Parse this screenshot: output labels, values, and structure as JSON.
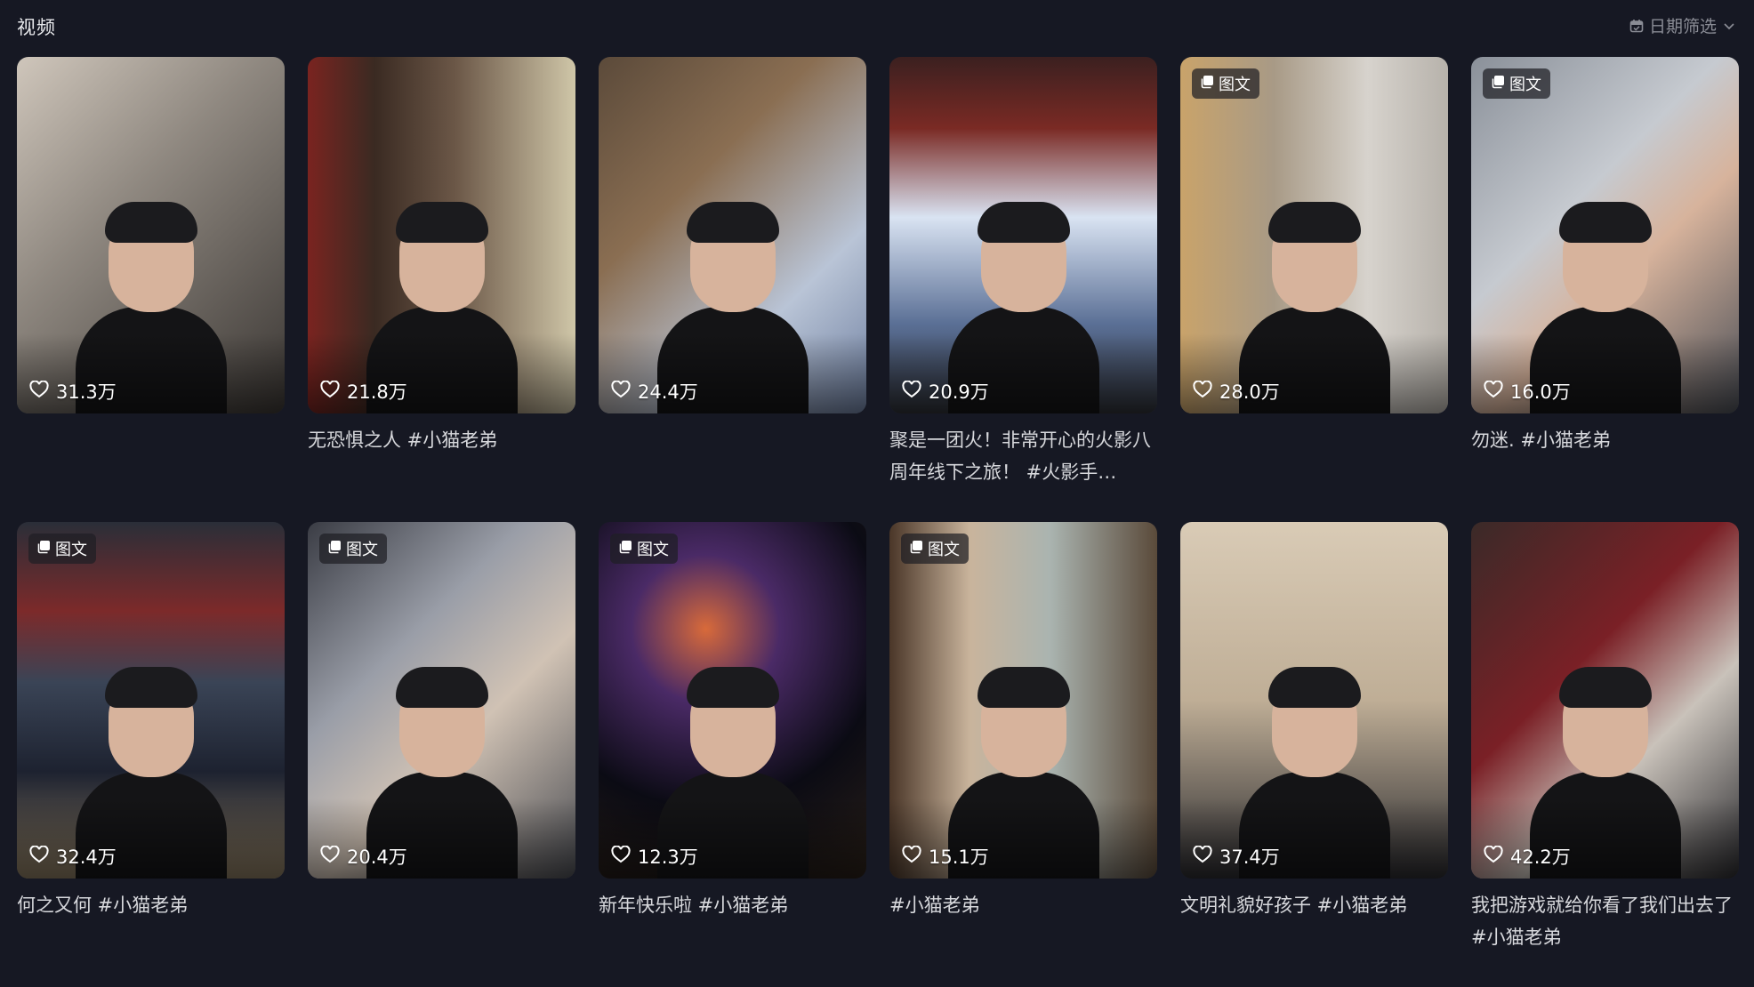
{
  "header": {
    "title": "视频",
    "filter_label": "日期筛选",
    "filter_icon": "calendar-icon",
    "chevron_icon": "chevron-down-icon"
  },
  "colors": {
    "background": "#161823",
    "text": "#e6e7ea",
    "muted": "#8a8c95"
  },
  "cards": [
    {
      "likes": "31.3万",
      "badge": "",
      "caption": "",
      "bg": "linear-gradient(135deg,#cfc6bb 0%,#8f8880 40%,#3a3633 100%)"
    },
    {
      "likes": "21.8万",
      "badge": "",
      "caption": "无恐惧之人 #小猫老弟",
      "bg": "linear-gradient(90deg,#7a2420 0%,#3a2a22 25%,#6b5747 55%,#cfc6a8 100%)"
    },
    {
      "likes": "24.4万",
      "badge": "",
      "caption": "",
      "bg": "linear-gradient(135deg,#5b4a3a 0%,#8a6e52 35%,#b9c4d6 70%,#6e7fa0 100%)"
    },
    {
      "likes": "20.9万",
      "badge": "",
      "caption": "聚是一团火！非常开心的火影八周年线下之旅！ #火影手…",
      "bg": "linear-gradient(180deg,#3b2020 0%,#7a2a24 20%,#d9e3f2 45%,#5a6f95 75%,#2e3036 100%)"
    },
    {
      "likes": "28.0万",
      "badge": "图文",
      "caption": "",
      "bg": "linear-gradient(90deg,#c9a36a 0%,#a89a86 35%,#d7d3cd 70%,#b7b2ab 100%)"
    },
    {
      "likes": "16.0万",
      "badge": "图文",
      "caption": "勿迷. #小猫老弟",
      "bg": "linear-gradient(135deg,#8a9099 0%,#c6cad0 40%,#d7b39c 60%,#4a4e56 100%)"
    },
    {
      "likes": "32.4万",
      "badge": "图文",
      "caption": "何之又何 #小猫老弟",
      "bg": "linear-gradient(180deg,#2a2e38 0%,#7c2a2a 25%,#3a4456 45%,#1d2230 70%,#8a7a60 100%)"
    },
    {
      "likes": "20.4万",
      "badge": "图文",
      "caption": "",
      "bg": "linear-gradient(135deg,#3a3c44 0%,#9a9ea8 35%,#d0c2b4 60%,#4a4c52 100%)"
    },
    {
      "likes": "12.3万",
      "badge": "图文",
      "caption": "新年快乐啦 #小猫老弟",
      "bg": "radial-gradient(circle at 40% 30%,#d86a3a 0%,#4a2a66 25%,#0b0b14 60%,#2a2018 100%)"
    },
    {
      "likes": "15.1万",
      "badge": "图文",
      "caption": "#小猫老弟",
      "bg": "linear-gradient(90deg,#4a3628 0%,#c9b49c 30%,#aab4b0 60%,#5a4a3a 100%)"
    },
    {
      "likes": "37.4万",
      "badge": "",
      "caption": "文明礼貌好孩子 #小猫老弟",
      "bg": "linear-gradient(180deg,#d9cbb6 0%,#bfae96 50%,#2a2a2e 100%)"
    },
    {
      "likes": "42.2万",
      "badge": "",
      "caption": "我把游戏就给你看了我们出去了 #小猫老弟",
      "bg": "linear-gradient(135deg,#3a2a28 0%,#7a2026 40%,#c9c2ba 65%,#2a2a2e 100%)"
    }
  ]
}
